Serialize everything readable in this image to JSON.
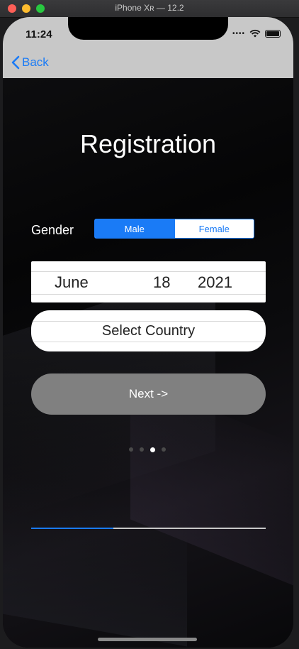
{
  "window": {
    "title": "iPhone Xʀ — 12.2"
  },
  "status_bar": {
    "time": "11:24"
  },
  "nav": {
    "back_label": "Back"
  },
  "screen": {
    "title": "Registration"
  },
  "gender": {
    "label": "Gender",
    "options": [
      "Male",
      "Female"
    ],
    "selected": "Male"
  },
  "date_picker": {
    "month": "June",
    "day": "18",
    "year": "2021"
  },
  "country_picker": {
    "label": "Select Country"
  },
  "next_button": {
    "label": "Next ->"
  },
  "page_control": {
    "count": 4,
    "current_index": 2
  },
  "progress": {
    "value": 0.35
  },
  "colors": {
    "accent": "#1a7bf6",
    "button_gray": "#808080"
  },
  "icons": [
    "back-chevron-icon",
    "wifi-icon",
    "battery-icon",
    "cellular-dots-icon"
  ]
}
